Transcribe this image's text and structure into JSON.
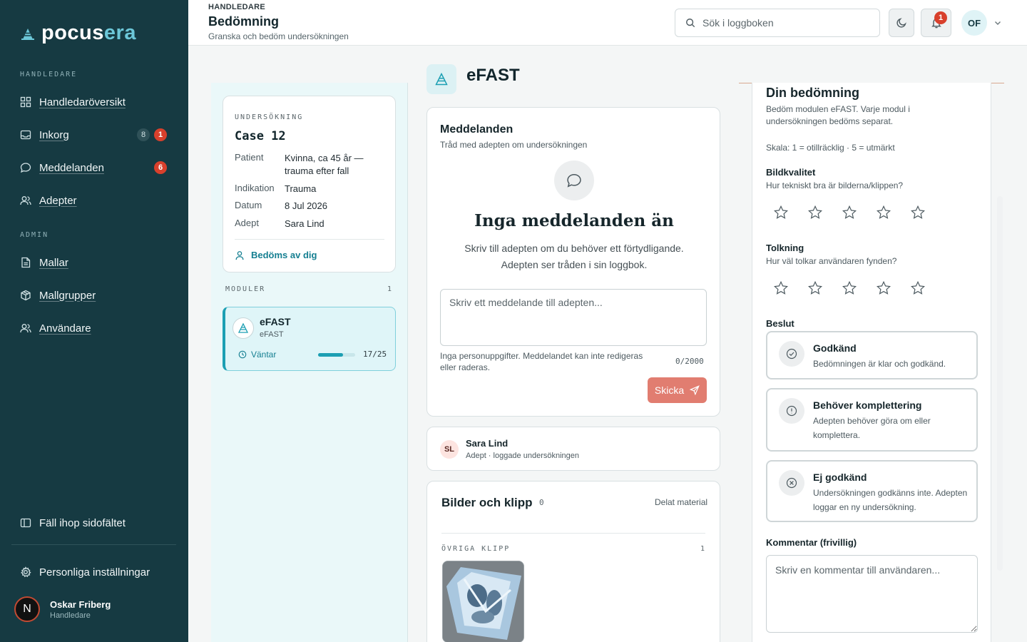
{
  "brand": {
    "part1": "pocus",
    "part2": "era"
  },
  "sidebar": {
    "section_supervisor": "HANDLEDARE",
    "section_admin": "ADMIN",
    "items": [
      {
        "label": "Handledaröversikt",
        "icon": "grid-icon"
      },
      {
        "label": "Inkorg",
        "icon": "inbox-icon",
        "count": "8",
        "badge": "1"
      },
      {
        "label": "Meddelanden",
        "icon": "chat-icon",
        "badge": "6"
      },
      {
        "label": "Adepter",
        "icon": "users-icon"
      },
      {
        "label": "Mallar",
        "icon": "document-icon"
      },
      {
        "label": "Mallgrupper",
        "icon": "package-icon"
      },
      {
        "label": "Användare",
        "icon": "users-icon"
      }
    ],
    "collapse_label": "Fäll ihop sidofältet",
    "settings_label": "Personliga inställningar",
    "user": {
      "initial": "N",
      "name": "Oskar Friberg",
      "role": "Handledare"
    }
  },
  "header": {
    "eyebrow": "HANDLEDARE",
    "title": "Bedömning",
    "subtitle": "Granska och bedöm undersökningen",
    "search_placeholder": "Sök i loggboken",
    "notification_count": "1",
    "avatar_initials": "OF"
  },
  "case": {
    "eyebrow": "UNDERSÖKNING",
    "title": "Case 12",
    "fields": [
      {
        "key": "Patient",
        "value": "Kvinna, ca 45 år — trauma efter fall"
      },
      {
        "key": "Indikation",
        "value": "Trauma"
      },
      {
        "key": "Datum",
        "value": "8 Jul 2026"
      },
      {
        "key": "Adept",
        "value": "Sara Lind"
      }
    ],
    "assessed_by": "Bedöms av dig"
  },
  "modules": {
    "label": "MODULER",
    "count": "1",
    "items": [
      {
        "name": "eFAST",
        "sub": "eFAST",
        "status": "Väntar",
        "progress_text": "17/25",
        "progress": 0.68
      }
    ]
  },
  "module_title": "eFAST",
  "messages": {
    "title": "Meddelanden",
    "subtitle": "Tråd med adepten om undersökningen",
    "empty_title": "Inga meddelanden än",
    "empty_desc": "Skriv till adepten om du behöver ett förtydligande. Adepten ser tråden i sin loggbok.",
    "placeholder": "Skriv ett meddelande till adepten...",
    "disclaimer": "Inga personuppgifter. Meddelandet kan inte redigeras eller raderas.",
    "char_count": "0/2000",
    "send_label": "Skicka"
  },
  "adept": {
    "initials": "SL",
    "name": "Sara Lind",
    "sub": "Adept · loggade undersökningen"
  },
  "media": {
    "title": "Bilder och klipp",
    "count": "0",
    "shared_label": "Delat material",
    "other_label": "ÖVRIGA KLIPP",
    "other_count": "1"
  },
  "assessment": {
    "title": "Din bedömning",
    "desc": "Bedöm modulen eFAST. Varje modul i undersökningen bedöms separat.",
    "scale": "Skala: 1 = otillräcklig · 5 = utmärkt",
    "criteria": [
      {
        "title": "Bildkvalitet",
        "question": "Hur tekniskt bra är bilderna/klippen?",
        "rating": 0
      },
      {
        "title": "Tolkning",
        "question": "Hur väl tolkar användaren fynden?",
        "rating": 0
      }
    ],
    "decision_label": "Beslut",
    "options": [
      {
        "title": "Godkänd",
        "desc": "Bedömningen är klar och godkänd.",
        "icon": "check-circle-icon"
      },
      {
        "title": "Behöver komplettering",
        "desc": "Adepten behöver göra om eller komplettera.",
        "icon": "alert-circle-icon"
      },
      {
        "title": "Ej godkänd",
        "desc": "Undersökningen godkänns inte. Adepten loggar en ny undersökning.",
        "icon": "x-circle-icon"
      }
    ],
    "comment_label": "Kommentar (frivillig)",
    "comment_placeholder": "Skriv en kommentar till användaren..."
  },
  "colors": {
    "sidebar": "#163a42",
    "accent": "#1c9fb3",
    "danger": "#d8402c",
    "send": "#e17d70"
  }
}
